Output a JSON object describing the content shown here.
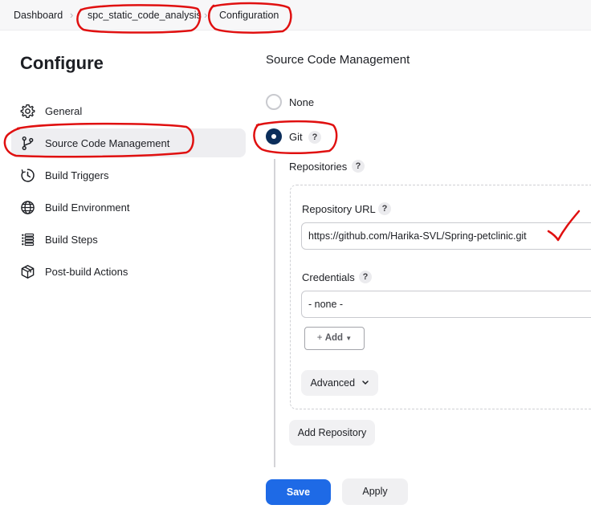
{
  "breadcrumb": {
    "items": [
      "Dashboard",
      "spc_static_code_analysis",
      "Configuration"
    ]
  },
  "sidebar": {
    "title": "Configure",
    "items": [
      {
        "label": "General",
        "icon": "gear-icon"
      },
      {
        "label": "Source Code Management",
        "icon": "branch-icon",
        "active": true
      },
      {
        "label": "Build Triggers",
        "icon": "clock-icon"
      },
      {
        "label": "Build Environment",
        "icon": "globe-icon"
      },
      {
        "label": "Build Steps",
        "icon": "list-icon"
      },
      {
        "label": "Post-build Actions",
        "icon": "package-icon"
      }
    ]
  },
  "scm": {
    "title": "Source Code Management",
    "none_label": "None",
    "git_label": "Git",
    "selected": "Git",
    "help": "?",
    "repositories_label": "Repositories",
    "repo_url_label": "Repository URL",
    "repo_url_value": "https://github.com/Harika-SVL/Spring-petclinic.git",
    "credentials_label": "Credentials",
    "credentials_value": "- none -",
    "add_label": "Add",
    "advanced_label": "Advanced",
    "add_repository_label": "Add Repository"
  },
  "actions": {
    "save_label": "Save",
    "apply_label": "Apply"
  },
  "colors": {
    "primary": "#1e6ae6",
    "radio_selected": "#0b2e5b",
    "annotation": "#e01010"
  }
}
